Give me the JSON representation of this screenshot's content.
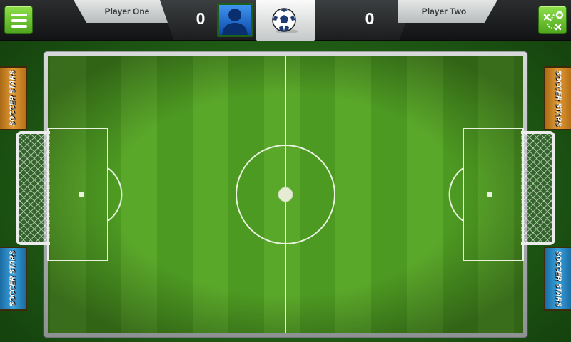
{
  "header": {
    "player_one": {
      "name": "Player One",
      "score": "0",
      "avatar_color": "#1b66d6"
    },
    "player_two": {
      "name": "Player Two",
      "score": "0",
      "avatar_color": "#e5601c"
    },
    "center_icon": "soccer-ball-icon",
    "menu_icon": "hamburger-menu-icon",
    "tactics_icon": "tactics-icon"
  },
  "field": {
    "grass_light": "#5aa82a",
    "grass_dark": "#3f8a1d",
    "line_color": "#e9f2de",
    "frame_color": "#a9abad"
  },
  "banners": {
    "text": "SOCCER STARS",
    "colors": {
      "orange": "#e0962f",
      "blue": "#2f8fcf"
    }
  }
}
